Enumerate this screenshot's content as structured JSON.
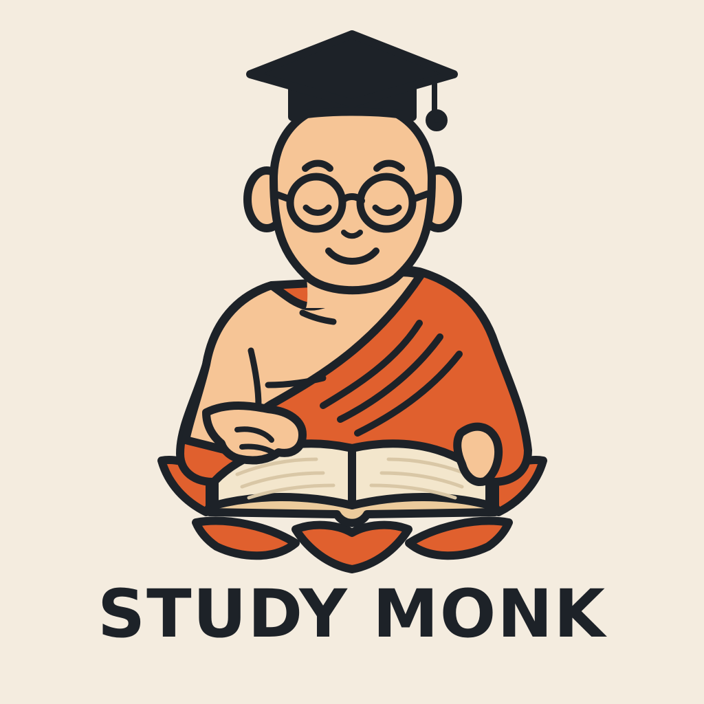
{
  "brand": {
    "name": "STUDY MONK"
  },
  "colors": {
    "background": "#f4ecdf",
    "outline": "#1d2228",
    "skin": "#f6c596",
    "skin_shadow": "#efb17c",
    "robe": "#e0602e",
    "robe_dark": "#c44e22",
    "page": "#f3e6cc",
    "page_edge": "#eccb9c",
    "cap": "#1d2228"
  },
  "icons": [
    "graduation-cap-icon",
    "monk-figure",
    "open-book-icon",
    "lotus-icon"
  ]
}
